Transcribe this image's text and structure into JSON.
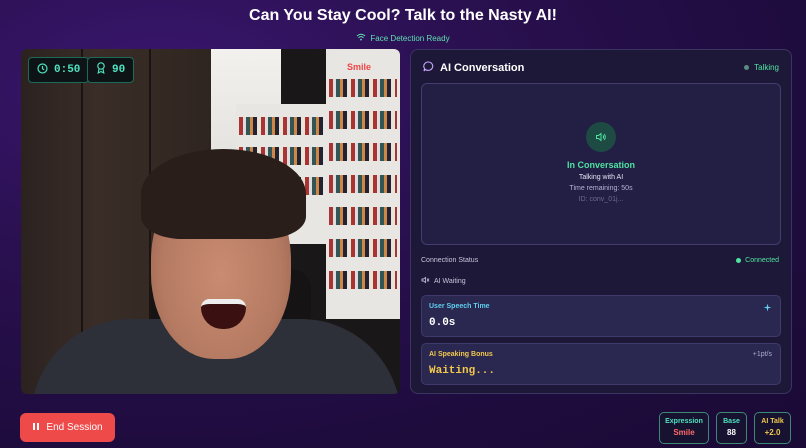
{
  "header": {
    "title": "Can You Stay Cool? Talk to the Nasty AI!",
    "face_status": "Face Detection Ready"
  },
  "video": {
    "timer": "0:50",
    "score": "90",
    "expression_tag": "Smile"
  },
  "conversation": {
    "title": "AI Conversation",
    "status": "Talking",
    "state_title": "In Conversation",
    "state_subtitle": "Talking with AI",
    "time_remaining": "Time remaining: 50s",
    "conversation_id": "ID: conv_01j...",
    "connection_label": "Connection Status",
    "connection_value": "Connected",
    "ai_state": "AI Waiting",
    "user_speech_label": "User Speech Time",
    "user_speech_value": "0.0s",
    "ai_bonus_label": "AI Speaking Bonus",
    "ai_bonus_rate": "+1pt/s",
    "ai_bonus_value": "Waiting..."
  },
  "footer": {
    "end_button": "End Session",
    "stats": [
      {
        "label": "Expression",
        "value": "Smile"
      },
      {
        "label": "Base",
        "value": "88"
      },
      {
        "label": "AI Talk",
        "value": "+2.0"
      }
    ]
  },
  "colors": {
    "accent_green": "#4fe3a0",
    "accent_teal": "#4fe3c0",
    "danger": "#ef4a4a",
    "bonus_yellow": "#f2c94c",
    "speech_cyan": "#5fd0f0"
  }
}
